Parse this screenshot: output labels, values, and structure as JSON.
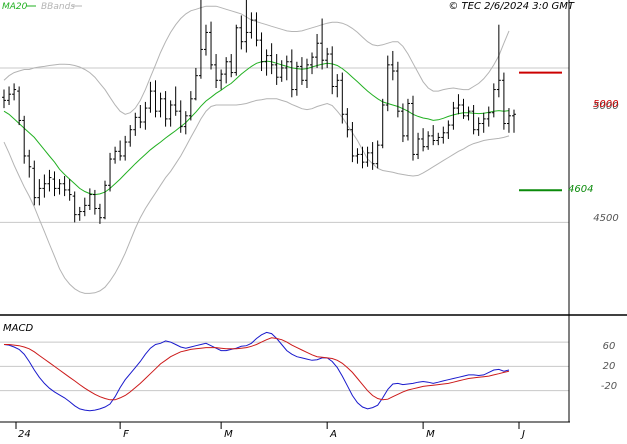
{
  "header": {
    "indicator_ma": "MA20",
    "indicator_bb": "BBands",
    "copyright": "© TEC 2/6/2024 3:0 GMT"
  },
  "colors": {
    "ma": "#22b022",
    "bands": "#b4b4b4",
    "price_bars": "#000000",
    "resistance": "#cc0000",
    "support": "#0a8a0a",
    "macd_line": "#1a1acc",
    "signal_line": "#cc1a1a",
    "grid": "#c8c8c8",
    "axis": "#000000"
  },
  "chart_data": [
    {
      "type": "ohlc",
      "name": "price",
      "y_ticks": [
        "5000",
        "4500"
      ],
      "ylim": [
        4200,
        5220
      ],
      "x_ticks": [
        "24",
        "F",
        "M",
        "A",
        "M",
        "J"
      ],
      "grid": true,
      "levels": [
        {
          "label": "5000",
          "value": 4985,
          "color": "#cc0000"
        },
        {
          "label": "4604",
          "value": 4604,
          "color": "#0a8a0a"
        }
      ],
      "ohlc": [
        [
          4905,
          4930,
          4870,
          4895
        ],
        [
          4895,
          4940,
          4880,
          4915
        ],
        [
          4915,
          4950,
          4895,
          4930
        ],
        [
          4925,
          4940,
          4815,
          4830
        ],
        [
          4830,
          4845,
          4690,
          4715
        ],
        [
          4715,
          4735,
          4645,
          4680
        ],
        [
          4675,
          4700,
          4555,
          4580
        ],
        [
          4580,
          4640,
          4555,
          4610
        ],
        [
          4610,
          4655,
          4580,
          4625
        ],
        [
          4625,
          4670,
          4600,
          4645
        ],
        [
          4640,
          4665,
          4585,
          4610
        ],
        [
          4610,
          4640,
          4590,
          4625
        ],
        [
          4625,
          4650,
          4585,
          4605
        ],
        [
          4605,
          4640,
          4570,
          4590
        ],
        [
          4585,
          4600,
          4500,
          4525
        ],
        [
          4525,
          4550,
          4505,
          4535
        ],
        [
          4535,
          4580,
          4520,
          4555
        ],
        [
          4555,
          4610,
          4540,
          4590
        ],
        [
          4590,
          4605,
          4525,
          4545
        ],
        [
          4545,
          4560,
          4495,
          4515
        ],
        [
          4515,
          4635,
          4510,
          4620
        ],
        [
          4620,
          4725,
          4600,
          4705
        ],
        [
          4705,
          4745,
          4690,
          4730
        ],
        [
          4730,
          4765,
          4700,
          4715
        ],
        [
          4715,
          4780,
          4700,
          4760
        ],
        [
          4760,
          4815,
          4745,
          4800
        ],
        [
          4800,
          4855,
          4780,
          4840
        ],
        [
          4840,
          4880,
          4805,
          4825
        ],
        [
          4825,
          4890,
          4800,
          4870
        ],
        [
          4870,
          4955,
          4855,
          4925
        ],
        [
          4925,
          4960,
          4840,
          4860
        ],
        [
          4860,
          4920,
          4840,
          4900
        ],
        [
          4900,
          4925,
          4810,
          4835
        ],
        [
          4835,
          4895,
          4810,
          4880
        ],
        [
          4880,
          4940,
          4845,
          4860
        ],
        [
          4860,
          4895,
          4790,
          4810
        ],
        [
          4810,
          4860,
          4785,
          4845
        ],
        [
          4845,
          4925,
          4830,
          4900
        ],
        [
          4900,
          5000,
          4895,
          4975
        ],
        [
          4975,
          5400,
          4965,
          5060
        ],
        [
          5060,
          5140,
          5040,
          5115
        ],
        [
          5115,
          5150,
          4995,
          5010
        ],
        [
          5010,
          5045,
          4935,
          4960
        ],
        [
          4960,
          4995,
          4930,
          4980
        ],
        [
          4980,
          5035,
          4950,
          5020
        ],
        [
          5020,
          5045,
          4970,
          4985
        ],
        [
          4985,
          5140,
          4975,
          5130
        ],
        [
          5130,
          5170,
          5060,
          5085
        ],
        [
          5085,
          5240,
          5050,
          5115
        ],
        [
          5115,
          5180,
          5095,
          5155
        ],
        [
          5155,
          5180,
          5070,
          5090
        ],
        [
          5090,
          5115,
          4990,
          5020
        ],
        [
          5020,
          5060,
          4975,
          5040
        ],
        [
          5040,
          5080,
          4980,
          5010
        ],
        [
          5010,
          5045,
          4945,
          4970
        ],
        [
          4970,
          5025,
          4955,
          5000
        ],
        [
          5000,
          5040,
          4960,
          5020
        ],
        [
          5020,
          5060,
          4905,
          4930
        ],
        [
          4930,
          5020,
          4910,
          5005
        ],
        [
          5005,
          5035,
          4945,
          4960
        ],
        [
          4960,
          5030,
          4935,
          5010
        ],
        [
          5010,
          5050,
          4980,
          5035
        ],
        [
          5035,
          5110,
          5000,
          5080
        ],
        [
          5080,
          5160,
          4995,
          5025
        ],
        [
          5025,
          5065,
          5000,
          5045
        ],
        [
          5045,
          5070,
          4915,
          4940
        ],
        [
          4940,
          4980,
          4905,
          4960
        ],
        [
          4960,
          4985,
          4820,
          4850
        ],
        [
          4850,
          4870,
          4775,
          4800
        ],
        [
          4800,
          4825,
          4695,
          4715
        ],
        [
          4715,
          4740,
          4690,
          4720
        ],
        [
          4720,
          4745,
          4675,
          4695
        ],
        [
          4695,
          4745,
          4680,
          4725
        ],
        [
          4725,
          4760,
          4670,
          4690
        ],
        [
          4690,
          4765,
          4675,
          4750
        ],
        [
          4750,
          4900,
          4740,
          4880
        ],
        [
          4880,
          5040,
          4860,
          5010
        ],
        [
          5010,
          5055,
          4960,
          4990
        ],
        [
          4990,
          5020,
          4840,
          4860
        ],
        [
          4860,
          4885,
          4760,
          4780
        ],
        [
          4780,
          4900,
          4765,
          4885
        ],
        [
          4885,
          4910,
          4700,
          4720
        ],
        [
          4720,
          4790,
          4705,
          4770
        ],
        [
          4770,
          4805,
          4730,
          4745
        ],
        [
          4745,
          4795,
          4735,
          4780
        ],
        [
          4780,
          4815,
          4750,
          4765
        ],
        [
          4765,
          4790,
          4750,
          4775
        ],
        [
          4775,
          4810,
          4755,
          4790
        ],
        [
          4790,
          4830,
          4770,
          4815
        ],
        [
          4815,
          4890,
          4800,
          4870
        ],
        [
          4870,
          4915,
          4850,
          4880
        ],
        [
          4880,
          4900,
          4835,
          4845
        ],
        [
          4845,
          4875,
          4830,
          4860
        ],
        [
          4860,
          4880,
          4785,
          4800
        ],
        [
          4800,
          4840,
          4780,
          4820
        ],
        [
          4820,
          4855,
          4790,
          4835
        ],
        [
          4835,
          4875,
          4810,
          4855
        ],
        [
          4855,
          4950,
          4840,
          4930
        ],
        [
          4930,
          5140,
          4905,
          4960
        ],
        [
          4960,
          4985,
          4800,
          4820
        ],
        [
          4820,
          4870,
          4790,
          4845
        ],
        [
          4845,
          4865,
          4790,
          4850
        ]
      ],
      "ma20": [
        4860,
        4850,
        4835,
        4820,
        4805,
        4790,
        4775,
        4755,
        4735,
        4715,
        4695,
        4672,
        4655,
        4640,
        4625,
        4610,
        4600,
        4593,
        4590,
        4592,
        4598,
        4610,
        4625,
        4640,
        4657,
        4673,
        4690,
        4705,
        4720,
        4735,
        4748,
        4760,
        4773,
        4785,
        4797,
        4810,
        4823,
        4840,
        4857,
        4876,
        4893,
        4905,
        4918,
        4928,
        4940,
        4950,
        4965,
        4980,
        4993,
        5005,
        5015,
        5020,
        5022,
        5020,
        5015,
        5010,
        5005,
        5000,
        4998,
        4996,
        4998,
        5003,
        5008,
        5012,
        5015,
        5013,
        5008,
        4998,
        4985,
        4970,
        4955,
        4940,
        4925,
        4912,
        4900,
        4890,
        4885,
        4880,
        4875,
        4868,
        4860,
        4850,
        4843,
        4838,
        4835,
        4830,
        4832,
        4837,
        4843,
        4848,
        4852,
        4855,
        4855,
        4853,
        4852,
        4853,
        4856,
        4860,
        4862,
        4860,
        4862
      ],
      "bb_upper": [
        4960,
        4975,
        4985,
        4990,
        4995,
        4995,
        5000,
        5003,
        5005,
        5008,
        5010,
        5012,
        5012,
        5011,
        5008,
        5003,
        4995,
        4985,
        4970,
        4950,
        4930,
        4905,
        4880,
        4860,
        4850,
        4855,
        4870,
        4895,
        4930,
        4970,
        5010,
        5050,
        5085,
        5115,
        5140,
        5160,
        5175,
        5185,
        5190,
        5195,
        5200,
        5200,
        5200,
        5195,
        5190,
        5185,
        5180,
        5175,
        5165,
        5155,
        5150,
        5145,
        5140,
        5135,
        5130,
        5125,
        5120,
        5118,
        5118,
        5120,
        5125,
        5130,
        5135,
        5140,
        5145,
        5148,
        5148,
        5145,
        5138,
        5128,
        5115,
        5100,
        5085,
        5075,
        5072,
        5075,
        5080,
        5085,
        5085,
        5070,
        5045,
        5015,
        4985,
        4955,
        4935,
        4925,
        4925,
        4930,
        4933,
        4935,
        4932,
        4930,
        4930,
        4940,
        4950,
        4965,
        4985,
        5010,
        5040,
        5080,
        5120
      ],
      "bb_lower": [
        4760,
        4725,
        4685,
        4650,
        4615,
        4585,
        4550,
        4510,
        4470,
        4430,
        4390,
        4350,
        4320,
        4300,
        4285,
        4275,
        4270,
        4270,
        4272,
        4278,
        4290,
        4310,
        4335,
        4365,
        4400,
        4440,
        4480,
        4515,
        4545,
        4570,
        4595,
        4620,
        4645,
        4665,
        4690,
        4715,
        4745,
        4775,
        4805,
        4835,
        4860,
        4875,
        4880,
        4880,
        4880,
        4880,
        4880,
        4882,
        4885,
        4890,
        4895,
        4897,
        4900,
        4900,
        4900,
        4895,
        4890,
        4882,
        4875,
        4868,
        4865,
        4868,
        4875,
        4880,
        4885,
        4878,
        4860,
        4840,
        4815,
        4790,
        4765,
        4735,
        4705,
        4690,
        4675,
        4668,
        4665,
        4662,
        4658,
        4655,
        4652,
        4650,
        4652,
        4660,
        4670,
        4680,
        4690,
        4700,
        4710,
        4720,
        4730,
        4738,
        4748,
        4755,
        4760,
        4765,
        4768,
        4770,
        4772,
        4775,
        4780
      ]
    },
    {
      "type": "line",
      "name": "MACD",
      "title": "MACD",
      "y_ticks": [
        "60",
        "20",
        "-20"
      ],
      "ylim": [
        -70,
        103
      ],
      "series": [
        {
          "color": "#1a1acc",
          "values": [
            56,
            55,
            52,
            48,
            40,
            28,
            14,
            2,
            -8,
            -16,
            -22,
            -27,
            -32,
            -38,
            -45,
            -50,
            -52,
            -53,
            -52,
            -50,
            -47,
            -42,
            -30,
            -15,
            -2,
            8,
            18,
            28,
            40,
            50,
            56,
            58,
            62,
            60,
            56,
            52,
            50,
            52,
            54,
            56,
            58,
            54,
            50,
            46,
            46,
            48,
            50,
            53,
            54,
            58,
            66,
            72,
            76,
            74,
            66,
            56,
            46,
            40,
            36,
            34,
            32,
            30,
            31,
            34,
            34,
            28,
            18,
            4,
            -12,
            -28,
            -40,
            -47,
            -50,
            -48,
            -44,
            -32,
            -18,
            -9,
            -8,
            -10,
            -9,
            -8,
            -6,
            -5,
            -6,
            -8,
            -6,
            -4,
            -2,
            0,
            2,
            4,
            6,
            6,
            5,
            6,
            10,
            14,
            15,
            12,
            14
          ]
        },
        {
          "color": "#cc1a1a",
          "values": [
            56,
            56,
            55,
            54,
            52,
            49,
            44,
            38,
            32,
            26,
            20,
            14,
            8,
            2,
            -4,
            -10,
            -16,
            -21,
            -26,
            -30,
            -33,
            -35,
            -35,
            -32,
            -28,
            -22,
            -15,
            -8,
            0,
            8,
            16,
            24,
            30,
            36,
            40,
            44,
            46,
            48,
            49,
            50,
            51,
            51,
            51,
            50,
            49,
            49,
            49,
            50,
            51,
            53,
            56,
            60,
            64,
            67,
            66,
            64,
            60,
            55,
            51,
            47,
            43,
            39,
            36,
            35,
            34,
            33,
            30,
            25,
            18,
            10,
            0,
            -10,
            -20,
            -28,
            -33,
            -35,
            -34,
            -30,
            -26,
            -22,
            -19,
            -17,
            -15,
            -13,
            -12,
            -11,
            -10,
            -9,
            -8,
            -6,
            -4,
            -2,
            0,
            1,
            2,
            3,
            4,
            6,
            8,
            10,
            12
          ]
        }
      ]
    }
  ]
}
